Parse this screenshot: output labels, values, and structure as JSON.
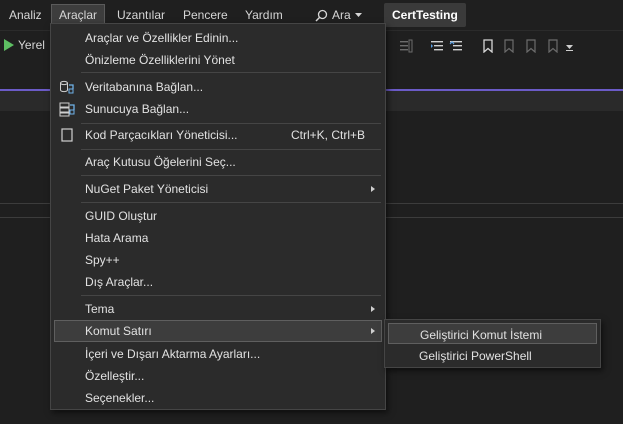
{
  "menubar": {
    "items": [
      "Analiz",
      "Araçlar",
      "Uzantılar",
      "Pencere",
      "Yardım"
    ],
    "search_label": "Ara",
    "project_name": "CertTesting"
  },
  "toolbar": {
    "run_label": "Yerel"
  },
  "tools_menu": {
    "items": [
      {
        "label": "Araçlar ve Özellikler Edinin..."
      },
      {
        "label": "Önizleme Özelliklerini Yönet"
      },
      {
        "label": "Veritabanına Bağlan...",
        "icon": "database-connect-icon"
      },
      {
        "label": "Sunucuya Bağlan...",
        "icon": "server-connect-icon"
      },
      {
        "label": "Kod Parçacıkları Yöneticisi...",
        "shortcut": "Ctrl+K, Ctrl+B",
        "icon": "snippet-icon"
      },
      {
        "label": "Araç Kutusu Öğelerini Seç..."
      },
      {
        "label": "NuGet Paket Yöneticisi",
        "submenu": true
      },
      {
        "label": "GUID Oluştur"
      },
      {
        "label": "Hata Arama"
      },
      {
        "label": "Spy++"
      },
      {
        "label": "Dış Araçlar..."
      },
      {
        "label": "Tema",
        "submenu": true
      },
      {
        "label": "Komut Satırı",
        "submenu": true,
        "highlighted": true
      },
      {
        "label": "İçeri ve Dışarı Aktarma Ayarları..."
      },
      {
        "label": "Özelleştir..."
      },
      {
        "label": "Seçenekler..."
      }
    ]
  },
  "command_line_submenu": {
    "items": [
      {
        "label": "Geliştirici Komut İstemi",
        "highlighted": true
      },
      {
        "label": "Geliştirici PowerShell"
      }
    ]
  },
  "colors": {
    "background": "#1f1f1f",
    "menu_background": "#2b2b2b",
    "highlight": "#3d3d3d",
    "accent": "#6b5bc7",
    "run_green": "#5dbe62"
  }
}
